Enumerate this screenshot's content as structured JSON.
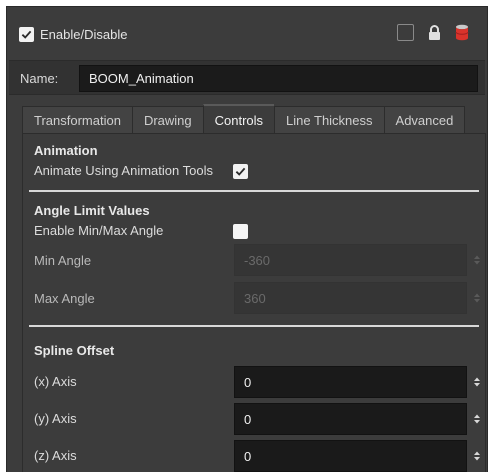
{
  "header": {
    "enable_label": "Enable/Disable",
    "enable_checked": true,
    "icons": [
      "square-icon",
      "lock-icon",
      "layer-color-icon"
    ]
  },
  "name": {
    "label": "Name:",
    "value": "BOOM_Animation"
  },
  "tabs": [
    {
      "label": "Transformation",
      "active": false
    },
    {
      "label": "Drawing",
      "active": false
    },
    {
      "label": "Controls",
      "active": true
    },
    {
      "label": "Line Thickness",
      "active": false
    },
    {
      "label": "Advanced",
      "active": false
    }
  ],
  "animation": {
    "title": "Animation",
    "animate_label": "Animate Using Animation Tools",
    "animate_checked": true
  },
  "angle_limit": {
    "title": "Angle Limit Values",
    "enable_label": "Enable Min/Max Angle",
    "enable_checked": false,
    "min_label": "Min Angle",
    "min_value": "-360",
    "max_label": "Max Angle",
    "max_value": "360"
  },
  "spline": {
    "title": "Spline Offset",
    "x_label": "(x) Axis",
    "x_value": "0",
    "y_label": "(y) Axis",
    "y_value": "0",
    "z_label": "(z) Axis",
    "z_value": "0"
  },
  "colors": {
    "panel_bg": "#3c3c3c",
    "input_bg": "#1a1a1a",
    "layer_icon_red": "#d9332b"
  }
}
